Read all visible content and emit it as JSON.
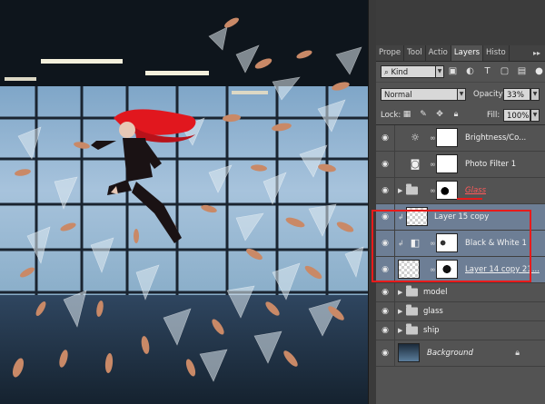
{
  "panel": {
    "tabs": [
      {
        "label": "Prope",
        "active": false
      },
      {
        "label": "Tool",
        "active": false
      },
      {
        "label": "Actio",
        "active": false
      },
      {
        "label": "Layers",
        "active": true
      },
      {
        "label": "Histo",
        "active": false
      }
    ],
    "tab_menu": "▸▸",
    "filter": {
      "kind_label": "Kind",
      "kind_icon": "search-icon",
      "icons": [
        "image-filter-icon",
        "adjustment-filter-icon",
        "type-filter-icon",
        "shape-filter-icon",
        "smart-object-filter-icon"
      ]
    },
    "blend_mode": "Normal",
    "opacity_label": "Opacity:",
    "opacity_value": "33%",
    "lock_label": "Lock:",
    "fill_label": "Fill:",
    "fill_value": "100%"
  },
  "layers": [
    {
      "name": "Brightness/Co...",
      "kind": "adjustment",
      "icon": "sun-icon",
      "selected": false
    },
    {
      "name": "Photo Filter 1",
      "kind": "adjustment",
      "icon": "camera-icon",
      "selected": false
    },
    {
      "name": "Glass",
      "kind": "group-mask",
      "selected": false,
      "highlight": true
    },
    {
      "name": "Layer 15 copy",
      "kind": "pixel",
      "clipped": true,
      "selected": true
    },
    {
      "name": "Black & White 1",
      "kind": "adjustment",
      "icon": "half-square-icon",
      "clipped": true,
      "selected": true
    },
    {
      "name": "Layer 14 copy 21...",
      "kind": "pixel",
      "selected": true,
      "underline": true
    },
    {
      "name": "model",
      "kind": "group",
      "selected": false
    },
    {
      "name": "glass",
      "kind": "group",
      "selected": false
    },
    {
      "name": "ship",
      "kind": "group",
      "selected": false
    },
    {
      "name": "Background",
      "kind": "background",
      "selected": false,
      "locked": true
    }
  ],
  "colors": {
    "selection": "#6d7e95",
    "panel_bg": "#535353",
    "highlight_red": "#e81b1b",
    "hair_red": "#e1171e"
  }
}
